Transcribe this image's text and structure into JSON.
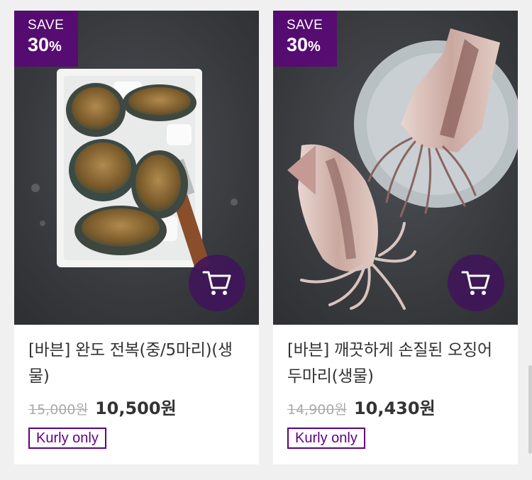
{
  "products": [
    {
      "badge_top": "SAVE",
      "badge_pct": "30",
      "badge_pct_sign": "%",
      "name": "[바븐] 완도 전복(중/5마리)(생물)",
      "original_price": "15,000원",
      "sale_price": "10,500원",
      "tag": "Kurly only",
      "image": "abalone-photo"
    },
    {
      "badge_top": "SAVE",
      "badge_pct": "30",
      "badge_pct_sign": "%",
      "name": "[바븐] 깨끗하게 손질된 오징어 두마리(생물)",
      "original_price": "14,900원",
      "sale_price": "10,430원",
      "tag": "Kurly only",
      "image": "squid-photo"
    }
  ],
  "colors": {
    "brand": "#5f0080",
    "cart_button": "#3d1a52",
    "background": "#f0f0f0"
  },
  "icons": {
    "cart": "cart-icon"
  }
}
